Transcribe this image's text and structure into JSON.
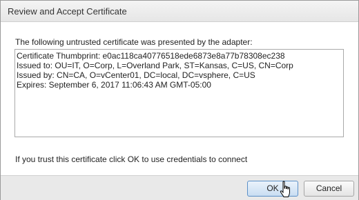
{
  "dialog": {
    "title": "Review and Accept Certificate",
    "intro_text": "The following untrusted certificate was presented by the adapter:",
    "certificate_lines": [
      "Certificate Thumbprint: e0ac118ca40776518ede6873e8a77b78308ec238",
      "Issued to: OU=IT, O=Corp, L=Overland Park, ST=Kansas, C=US, CN=Corp",
      "Issued by: CN=CA, O=vCenter01, DC=local, DC=vsphere, C=US",
      "Expires: September 6, 2017 11:06:43 AM GMT-05:00"
    ],
    "trust_text": "If you trust this certificate click OK to use credentials to connect"
  },
  "buttons": {
    "ok_label": "OK",
    "cancel_label": "Cancel"
  },
  "icons": {
    "pointer": "hand-pointer-icon"
  },
  "colors": {
    "ok_border": "#5a8fc7",
    "footer_bg": "#e9e9e9"
  }
}
